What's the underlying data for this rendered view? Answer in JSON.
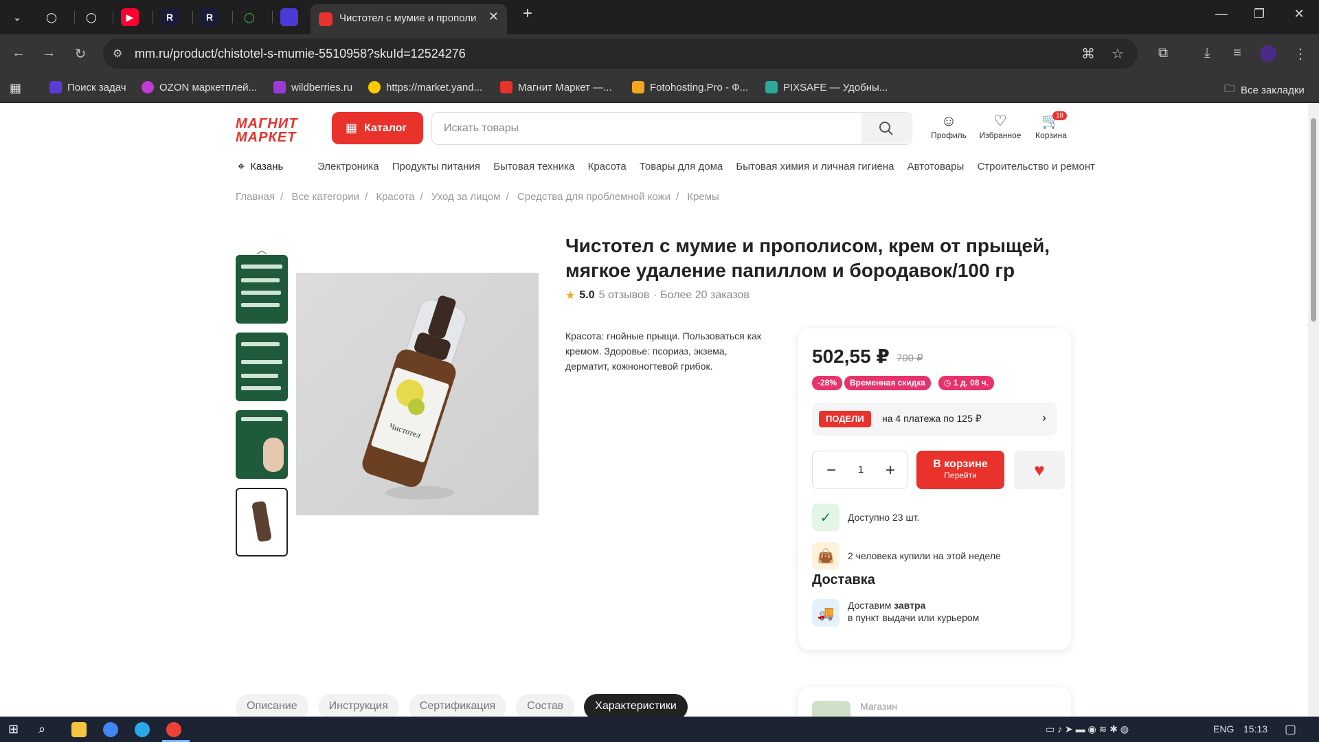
{
  "browser": {
    "active_tab_title": "Чистотел с мумие и прополис",
    "url": "mm.ru/product/chistotel-s-mumie-5510958?skuId=12524276",
    "bookmarks": [
      "Поиск задач",
      "OZON маркетплей...",
      "wildberries.ru",
      "https://market.yand...",
      "Магнит Маркет —...",
      "Fotohosting.Pro - Ф...",
      "PIXSAFE — Удобны..."
    ],
    "all_bookmarks": "Все закладки"
  },
  "header": {
    "logo_line1": "МАГНИТ",
    "logo_line2": "МАРКЕТ",
    "catalog_label": "Каталог",
    "search_placeholder": "Искать товары",
    "profile_label": "Профиль",
    "favorites_label": "Избранное",
    "cart_label": "Корзина",
    "cart_count": "18"
  },
  "nav": {
    "city": "Казань",
    "categories": [
      "Электроника",
      "Продукты питания",
      "Бытовая техника",
      "Красота",
      "Товары для дома",
      "Бытовая химия и личная гигиена",
      "Автотовары",
      "Строительство и ремонт"
    ]
  },
  "breadcrumbs": [
    "Главная",
    "Все категории",
    "Красота",
    "Уход за лицом",
    "Средства для проблемной кожи",
    "Кремы"
  ],
  "product": {
    "title": "Чистотел с мумие и прополисом, крем от прыщей, мягкое удаление папиллом и бородавок/100 гр",
    "rating": "5.0",
    "reviews": "5 отзывов",
    "orders": "· Более 20 заказов",
    "description": "Красота: гнойные прыщи. Пользоваться как кремом. Здоровье: псориаз, экзема, дерматит, кожноногтевой грибок.",
    "bottle_label": "Чистотел"
  },
  "buybox": {
    "price": "502,55 ₽",
    "old_price": "700 ₽",
    "discount": "-28%",
    "promo": "Временная скидка",
    "timer": "1 д. 08 ч.",
    "split_tag": "ПОДЕЛИ",
    "split_text": "на 4 платежа по 125 ₽",
    "quantity": "1",
    "in_cart": "В корзине",
    "go": "Перейти",
    "available": "Доступно 23 шт.",
    "bought": "2 человека купили на этой неделе",
    "delivery_heading": "Доставка",
    "delivery_prefix": "Доставим ",
    "delivery_when": "завтра",
    "delivery_where": "в пункт выдачи или курьером"
  },
  "tabs": [
    "Описание",
    "Инструкция",
    "Сертификация",
    "Состав",
    "Характеристики"
  ],
  "store_label": "Магазин",
  "taskbar": {
    "lang": "ENG",
    "time": "15:13"
  },
  "colors": {
    "brand_red": "#e8322b",
    "promo_pink": "#e8326b"
  }
}
